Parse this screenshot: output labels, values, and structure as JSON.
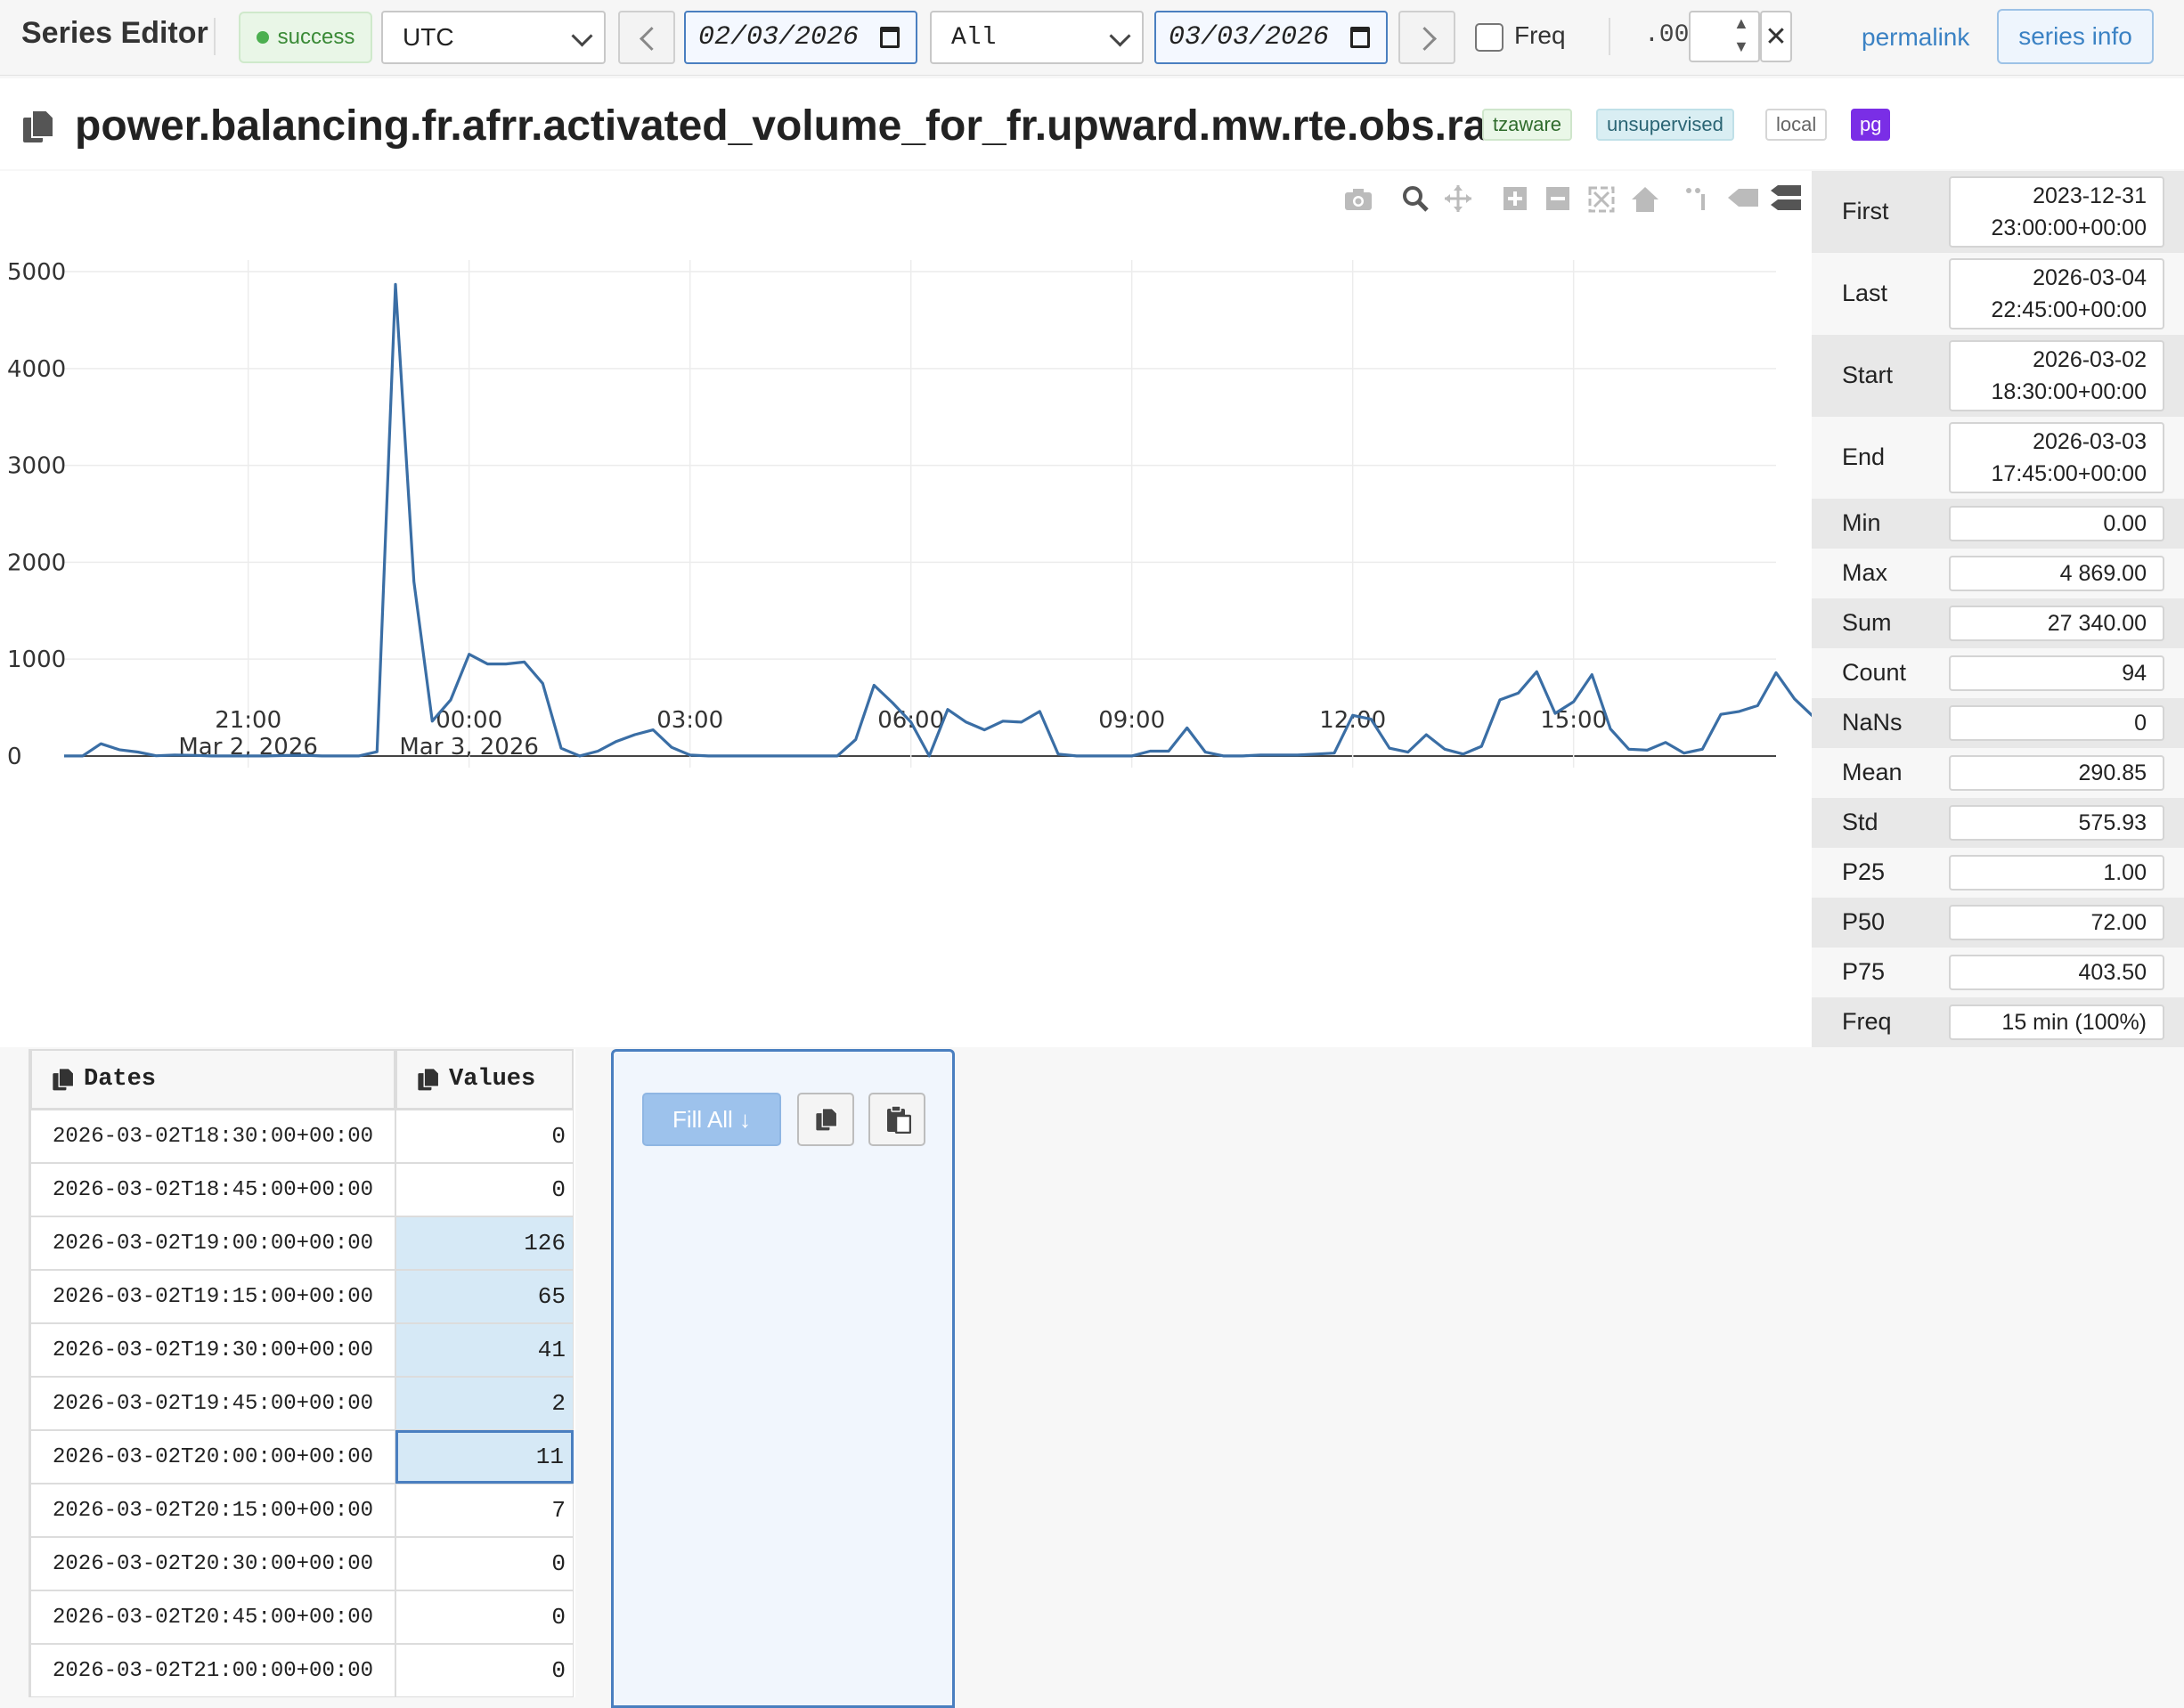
{
  "toolbar": {
    "app_title": "Series Editor",
    "status": "success",
    "timezone": "UTC",
    "start_date": "02/03/2026",
    "mode": "All",
    "end_date": "03/03/2026",
    "freq_label": "Freq",
    "decimals_label": ".00",
    "clear_label": "✕",
    "permalink": "permalink",
    "series_info": "series info"
  },
  "series": {
    "name": "power.balancing.fr.afrr.activated_volume_for_fr.upward.mw.rte.obs.raw",
    "tags": [
      "tzaware",
      "unsupervised",
      "local",
      "pg"
    ]
  },
  "stats": [
    {
      "label": "First",
      "value": [
        "2023-12-31",
        "23:00:00+00:00"
      ]
    },
    {
      "label": "Last",
      "value": [
        "2026-03-04",
        "22:45:00+00:00"
      ]
    },
    {
      "label": "Start",
      "value": [
        "2026-03-02",
        "18:30:00+00:00"
      ]
    },
    {
      "label": "End",
      "value": [
        "2026-03-03",
        "17:45:00+00:00"
      ]
    },
    {
      "label": "Min",
      "value": [
        "0.00"
      ]
    },
    {
      "label": "Max",
      "value": [
        "4 869.00"
      ]
    },
    {
      "label": "Sum",
      "value": [
        "27 340.00"
      ]
    },
    {
      "label": "Count",
      "value": [
        "94"
      ]
    },
    {
      "label": "NaNs",
      "value": [
        "0"
      ]
    },
    {
      "label": "Mean",
      "value": [
        "290.85"
      ]
    },
    {
      "label": "Std",
      "value": [
        "575.93"
      ]
    },
    {
      "label": "P25",
      "value": [
        "1.00"
      ]
    },
    {
      "label": "P50",
      "value": [
        "72.00"
      ]
    },
    {
      "label": "P75",
      "value": [
        "403.50"
      ]
    },
    {
      "label": "Freq",
      "value": [
        "15 min (100%)"
      ]
    }
  ],
  "grid": {
    "headers": [
      "Dates",
      "Values"
    ],
    "rows": [
      {
        "date": "2026-03-02T18:30:00+00:00",
        "value": "0",
        "state": ""
      },
      {
        "date": "2026-03-02T18:45:00+00:00",
        "value": "0",
        "state": ""
      },
      {
        "date": "2026-03-02T19:00:00+00:00",
        "value": "126",
        "state": "sel"
      },
      {
        "date": "2026-03-02T19:15:00+00:00",
        "value": "65",
        "state": "sel"
      },
      {
        "date": "2026-03-02T19:30:00+00:00",
        "value": "41",
        "state": "sel"
      },
      {
        "date": "2026-03-02T19:45:00+00:00",
        "value": "2",
        "state": "sel"
      },
      {
        "date": "2026-03-02T20:00:00+00:00",
        "value": "11",
        "state": "active"
      },
      {
        "date": "2026-03-02T20:15:00+00:00",
        "value": "7",
        "state": ""
      },
      {
        "date": "2026-03-02T20:30:00+00:00",
        "value": "0",
        "state": ""
      },
      {
        "date": "2026-03-02T20:45:00+00:00",
        "value": "0",
        "state": ""
      },
      {
        "date": "2026-03-02T21:00:00+00:00",
        "value": "0",
        "state": ""
      }
    ]
  },
  "panel": {
    "fill_all": "Fill All ↓"
  },
  "colors": {
    "line": "#3a6ea5",
    "accent": "#3b82c4"
  },
  "chart_data": {
    "type": "line",
    "x_ticks": [
      {
        "h": 21,
        "label": [
          "21:00",
          "Mar 2, 2026"
        ]
      },
      {
        "h": 24,
        "label": [
          "00:00",
          "Mar 3, 2026"
        ]
      },
      {
        "h": 27,
        "label": [
          "03:00"
        ]
      },
      {
        "h": 30,
        "label": [
          "06:00"
        ]
      },
      {
        "h": 33,
        "label": [
          "09:00"
        ]
      },
      {
        "h": 36,
        "label": [
          "12:00"
        ]
      },
      {
        "h": 39,
        "label": [
          "15:00"
        ]
      }
    ],
    "y_ticks": [
      0,
      1000,
      2000,
      3000,
      4000,
      5000
    ],
    "xlim": [
      18.5,
      41.75
    ],
    "ylim": [
      -120,
      5120
    ],
    "values": [
      0,
      0,
      126,
      65,
      41,
      2,
      11,
      7,
      0,
      0,
      0,
      0,
      5,
      8,
      0,
      0,
      0,
      44,
      4869,
      1800,
      360,
      580,
      1050,
      950,
      950,
      970,
      750,
      80,
      0,
      50,
      150,
      220,
      270,
      90,
      10,
      0,
      0,
      0,
      0,
      0,
      0,
      0,
      0,
      170,
      730,
      550,
      350,
      0,
      480,
      350,
      270,
      360,
      350,
      460,
      20,
      0,
      0,
      0,
      0,
      50,
      50,
      290,
      40,
      0,
      0,
      10,
      10,
      10,
      20,
      30,
      420,
      380,
      80,
      40,
      220,
      70,
      20,
      100,
      580,
      650,
      870,
      440,
      560,
      840,
      280,
      70,
      60,
      140,
      30,
      70,
      430,
      460,
      520,
      860,
      590,
      410
    ]
  }
}
